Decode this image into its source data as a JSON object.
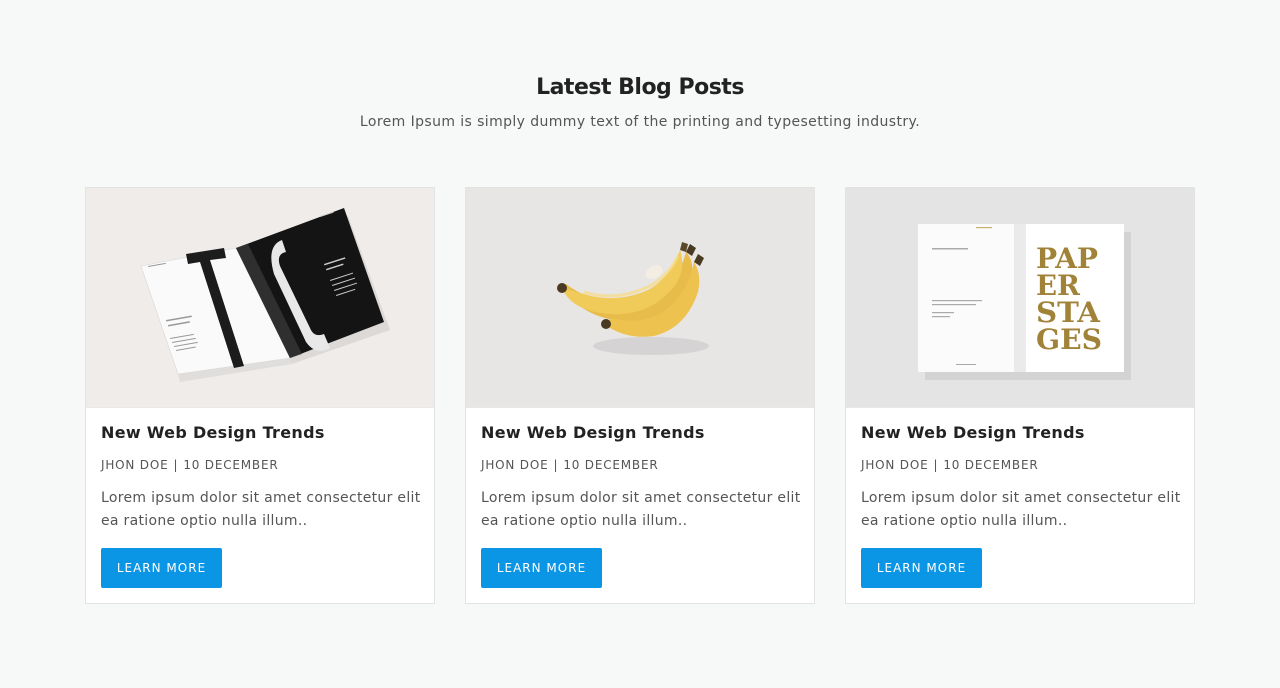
{
  "section": {
    "title": "Latest Blog Posts",
    "subtitle": "Lorem Ipsum is simply dummy text of the printing and typesetting industry."
  },
  "posts": [
    {
      "title": "New Web Design Trends",
      "author": "JHON DOE",
      "separator": "|",
      "date": "10 DECEMBER",
      "excerpt": "Lorem ipsum dolor sit amet consectetur elit ea ratione optio nulla illum..",
      "button_label": "LEARN MORE",
      "image": "magazine-photo"
    },
    {
      "title": "New Web Design Trends",
      "author": "JHON DOE",
      "separator": "|",
      "date": "10 DECEMBER",
      "excerpt": "Lorem ipsum dolor sit amet consectetur elit ea ratione optio nulla illum..",
      "button_label": "LEARN MORE",
      "image": "banana-photo"
    },
    {
      "title": "New Web Design Trends",
      "author": "JHON DOE",
      "separator": "|",
      "date": "10 DECEMBER",
      "excerpt": "Lorem ipsum dolor sit amet consectetur elit ea ratione optio nulla illum..",
      "button_label": "LEARN MORE",
      "image": "paper-stages-book-photo"
    }
  ],
  "colors": {
    "page_background": "#f7f8f8",
    "card_background": "#ffffff",
    "button": "#0a95e5",
    "button_text": "#ffffff",
    "heading": "#222222",
    "body_text": "#555555",
    "gold": "#a08338"
  }
}
